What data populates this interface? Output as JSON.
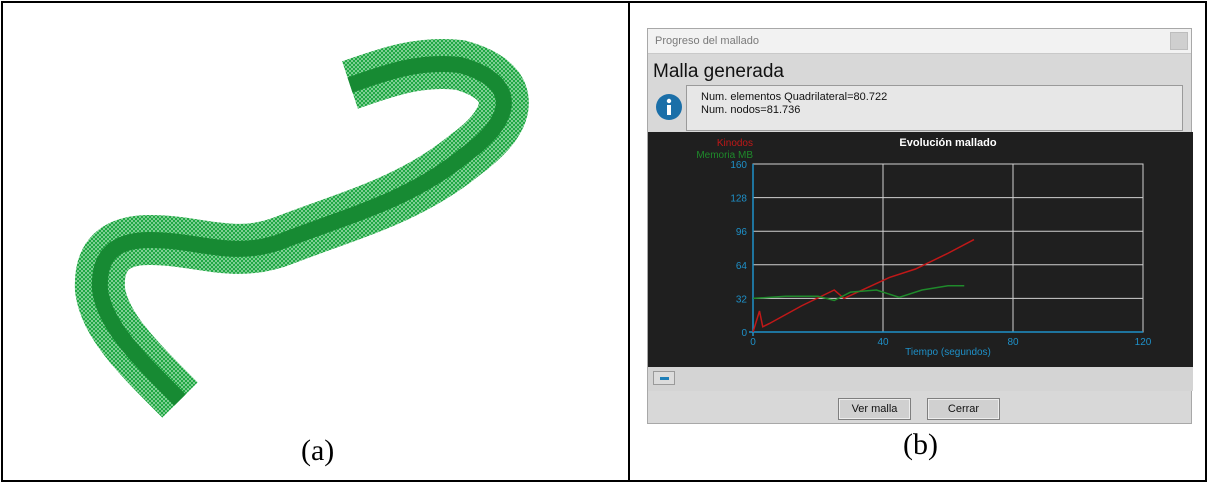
{
  "captions": {
    "left": "(a)",
    "right": "(b)"
  },
  "window": {
    "title": "Progreso del mallado",
    "heading": "Malla generada",
    "info_lines": [
      "Num. elementos Quadrilateral=80.722",
      "Num. nodos=81.736"
    ],
    "buttons": {
      "view": "Ver malla",
      "close": "Cerrar"
    }
  },
  "colors": {
    "mesh": "#1a9c3a",
    "series_red": "#c01818",
    "series_green": "#1f8a2b",
    "axis": "#1e90c8"
  },
  "chart_data": {
    "type": "line",
    "title": "Evolución mallado",
    "xlabel": "Tiempo (segundos)",
    "ylabel": "",
    "xlim": [
      0,
      120
    ],
    "ylim": [
      0,
      160
    ],
    "x_ticks": [
      "0",
      "40",
      "80",
      "120"
    ],
    "y_ticks": [
      "0",
      "32",
      "64",
      "96",
      "128",
      "160"
    ],
    "grid": true,
    "legend": [
      "Kinodos",
      "Memoria MB"
    ],
    "series": [
      {
        "name": "Kinodos",
        "color": "#c01818",
        "points": [
          [
            0,
            0
          ],
          [
            2,
            20
          ],
          [
            3,
            5
          ],
          [
            5,
            8
          ],
          [
            15,
            25
          ],
          [
            25,
            40
          ],
          [
            28,
            32
          ],
          [
            35,
            42
          ],
          [
            42,
            52
          ],
          [
            50,
            60
          ],
          [
            60,
            75
          ],
          [
            68,
            88
          ]
        ]
      },
      {
        "name": "Memoria MB",
        "color": "#1f8a2b",
        "points": [
          [
            0,
            32
          ],
          [
            10,
            34
          ],
          [
            20,
            34
          ],
          [
            25,
            30
          ],
          [
            30,
            38
          ],
          [
            38,
            40
          ],
          [
            45,
            33
          ],
          [
            52,
            40
          ],
          [
            60,
            44
          ],
          [
            65,
            44
          ]
        ]
      }
    ]
  }
}
